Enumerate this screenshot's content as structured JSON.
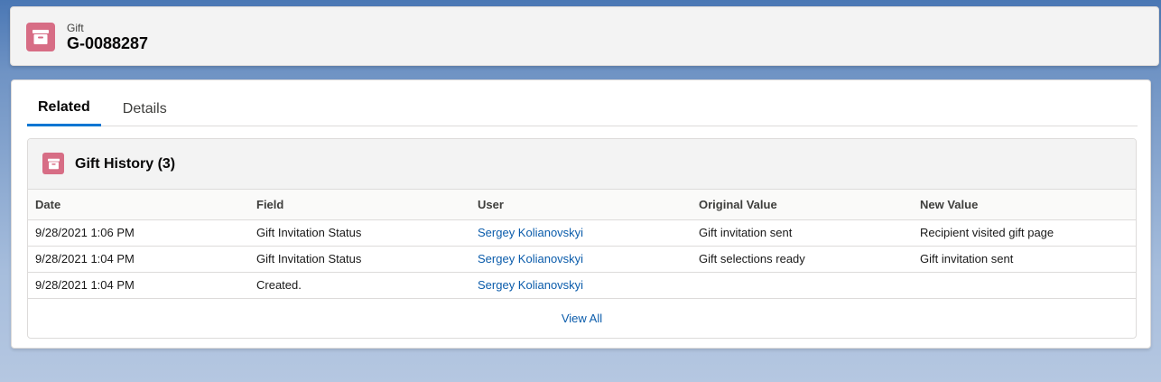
{
  "header": {
    "eyebrow": "Gift",
    "title": "G-0088287",
    "icon": "archive-box-icon",
    "icon_color": "#d76d85"
  },
  "tabs": [
    {
      "label": "Related",
      "active": true
    },
    {
      "label": "Details",
      "active": false
    }
  ],
  "related_list": {
    "title": "Gift History (3)",
    "icon": "archive-box-icon",
    "columns": [
      "Date",
      "Field",
      "User",
      "Original Value",
      "New Value"
    ],
    "rows": [
      {
        "date": "9/28/2021 1:06 PM",
        "field": "Gift Invitation Status",
        "user": "Sergey Kolianovskyi",
        "original": "Gift invitation sent",
        "new": "Recipient visited gift page"
      },
      {
        "date": "9/28/2021 1:04 PM",
        "field": "Gift Invitation Status",
        "user": "Sergey Kolianovskyi",
        "original": "Gift selections ready",
        "new": "Gift invitation sent"
      },
      {
        "date": "9/28/2021 1:04 PM",
        "field": "Created.",
        "user": "Sergey Kolianovskyi",
        "original": "",
        "new": ""
      }
    ],
    "view_all_label": "View All"
  },
  "colors": {
    "accent": "#0176d3",
    "link": "#0b5cab",
    "background": "#4a77b4"
  }
}
